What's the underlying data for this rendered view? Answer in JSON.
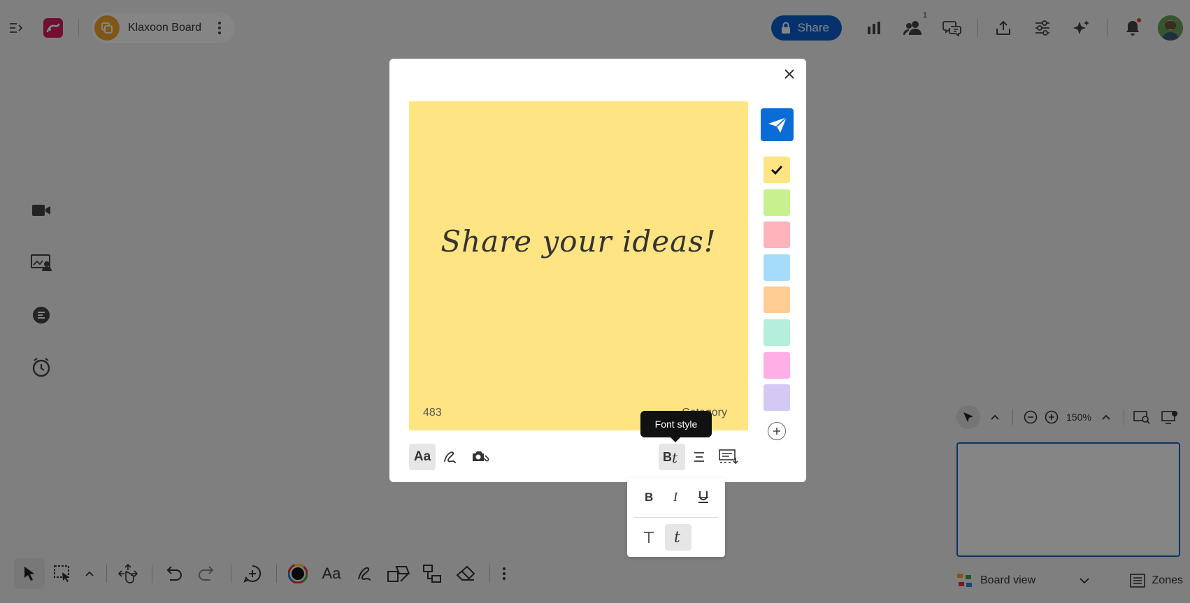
{
  "topbar": {
    "board_name": "Klaxoon Board",
    "share_label": "Share",
    "participants_badge": "1"
  },
  "note": {
    "text": "Share your ideas!",
    "count": "483",
    "category": "Category",
    "colors": [
      "#ffe483",
      "#c8f08e",
      "#ffb3ba",
      "#a6dcfb",
      "#ffcc91",
      "#b4efdd",
      "#ffaee6",
      "#d4c8f5"
    ],
    "selected_color": "#ffe483"
  },
  "tooltip": {
    "text": "Font style"
  },
  "navigation": {
    "zoom": "150%",
    "view_label": "Board view",
    "zones_label": "Zones"
  },
  "accent": {
    "primary": "#0a5fd1",
    "send": "#0a6cd6",
    "logo": "#d81b60",
    "board_avatar": "#f4a62a"
  }
}
